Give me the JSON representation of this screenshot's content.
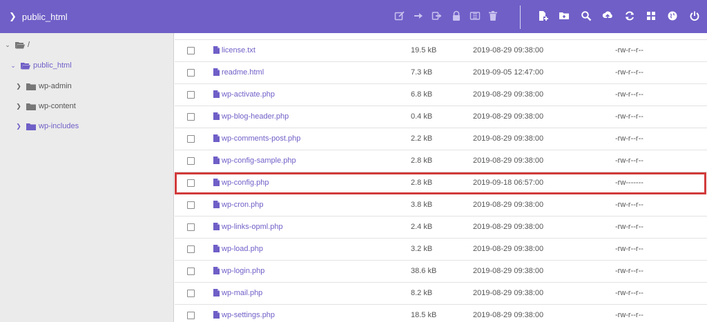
{
  "header": {
    "breadcrumb": "public_html",
    "accent_color": "#6f5fc7",
    "left_icons": [
      "edit-icon",
      "move-icon",
      "export-icon",
      "lock-icon",
      "compress-icon",
      "trash-icon"
    ],
    "right_icons": [
      "new-file-icon",
      "new-folder-icon",
      "search-icon",
      "upload-icon",
      "refresh-icon",
      "grid-view-icon",
      "globe-icon",
      "power-icon"
    ]
  },
  "sidebar": {
    "root": "/",
    "items": [
      {
        "label": "public_html"
      },
      {
        "label": "wp-admin"
      },
      {
        "label": "wp-content"
      },
      {
        "label": "wp-includes"
      }
    ]
  },
  "files": [
    {
      "name": "license.txt",
      "size": "19.5 kB",
      "date": "2019-08-29 09:38:00",
      "perm": "-rw-r--r--"
    },
    {
      "name": "readme.html",
      "size": "7.3 kB",
      "date": "2019-09-05 12:47:00",
      "perm": "-rw-r--r--"
    },
    {
      "name": "wp-activate.php",
      "size": "6.8 kB",
      "date": "2019-08-29 09:38:00",
      "perm": "-rw-r--r--"
    },
    {
      "name": "wp-blog-header.php",
      "size": "0.4 kB",
      "date": "2019-08-29 09:38:00",
      "perm": "-rw-r--r--"
    },
    {
      "name": "wp-comments-post.php",
      "size": "2.2 kB",
      "date": "2019-08-29 09:38:00",
      "perm": "-rw-r--r--"
    },
    {
      "name": "wp-config-sample.php",
      "size": "2.8 kB",
      "date": "2019-08-29 09:38:00",
      "perm": "-rw-r--r--"
    },
    {
      "name": "wp-config.php",
      "size": "2.8 kB",
      "date": "2019-09-18 06:57:00",
      "perm": "-rw-------",
      "highlight_color": "#d13a3a"
    },
    {
      "name": "wp-cron.php",
      "size": "3.8 kB",
      "date": "2019-08-29 09:38:00",
      "perm": "-rw-r--r--"
    },
    {
      "name": "wp-links-opml.php",
      "size": "2.4 kB",
      "date": "2019-08-29 09:38:00",
      "perm": "-rw-r--r--"
    },
    {
      "name": "wp-load.php",
      "size": "3.2 kB",
      "date": "2019-08-29 09:38:00",
      "perm": "-rw-r--r--"
    },
    {
      "name": "wp-login.php",
      "size": "38.6 kB",
      "date": "2019-08-29 09:38:00",
      "perm": "-rw-r--r--"
    },
    {
      "name": "wp-mail.php",
      "size": "8.2 kB",
      "date": "2019-08-29 09:38:00",
      "perm": "-rw-r--r--"
    },
    {
      "name": "wp-settings.php",
      "size": "18.5 kB",
      "date": "2019-08-29 09:38:00",
      "perm": "-rw-r--r--"
    }
  ]
}
